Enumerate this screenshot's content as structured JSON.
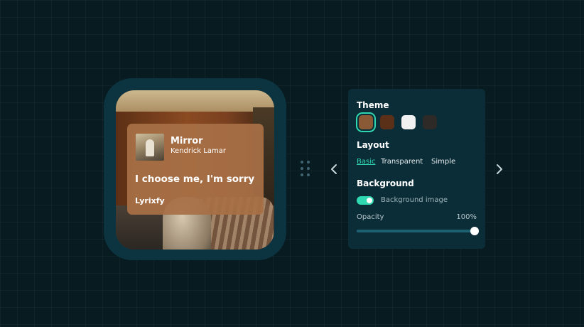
{
  "widget": {
    "song_title": "Mirror",
    "artist": "Kendrick Lamar",
    "lyric": "I choose me, I'm sorry",
    "brand": "Lyrixfy"
  },
  "panel": {
    "theme_heading": "Theme",
    "themes": [
      {
        "name": "brown",
        "color": "#8a5a36",
        "selected": true
      },
      {
        "name": "dark-brown",
        "color": "#5a3018",
        "selected": false
      },
      {
        "name": "white",
        "color": "#f1f1f1",
        "selected": false
      },
      {
        "name": "charcoal",
        "color": "#2d2a28",
        "selected": false
      }
    ],
    "layout_heading": "Layout",
    "layouts": [
      "Basic",
      "Transparent",
      "Simple"
    ],
    "active_layout": "Basic",
    "background_heading": "Background",
    "background_image_label": "Background image",
    "background_image_enabled": true,
    "opacity_label": "Opacity",
    "opacity_value": "100%",
    "opacity": 1.0
  },
  "icons": {
    "prev": "chevron-left-icon",
    "next": "chevron-right-icon",
    "drag": "drag-handle-icon"
  },
  "colors": {
    "accent": "#2fd8b0",
    "background": "#071b20",
    "panel": "#0b2d38",
    "frame": "#0c3440"
  }
}
